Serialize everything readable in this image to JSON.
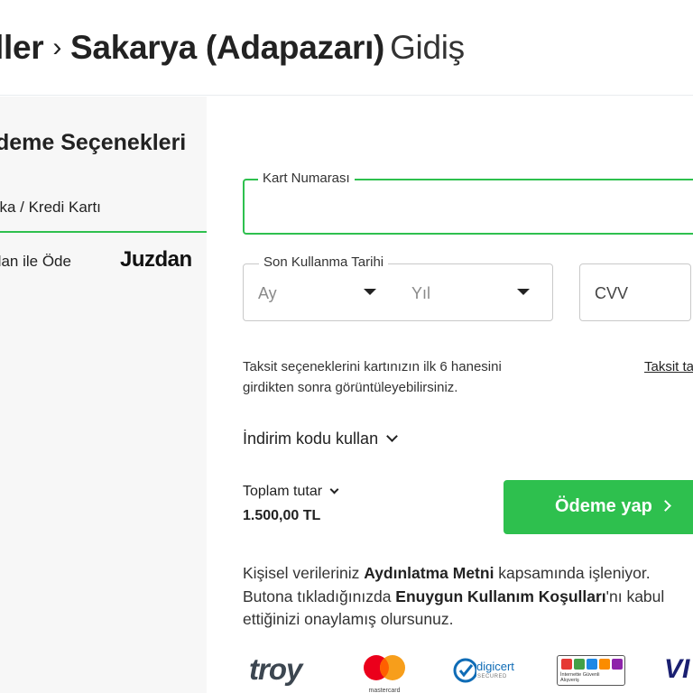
{
  "header": {
    "origin": "ller",
    "destination": "Sakarya (Adapazarı)",
    "direction": "Gidiş"
  },
  "sidebar": {
    "title": "deme Seçenekleri",
    "tabs": [
      {
        "label": "nka / Kredi Kartı",
        "active": true
      },
      {
        "label": "dan ile Öde",
        "logo": "Juzdan"
      }
    ]
  },
  "form": {
    "card_number_label": "Kart Numarası",
    "card_number_value": "",
    "expiry_label": "Son Kullanma Tarihi",
    "month_placeholder": "Ay",
    "year_placeholder": "Yıl",
    "cvv_placeholder": "CVV"
  },
  "installment": {
    "info": "Taksit seçeneklerini kartınızın ilk 6 hanesini girdikten sonra görüntüleyebilirsiniz.",
    "link": "Taksit ta"
  },
  "discount": {
    "label": "İndirim kodu kullan"
  },
  "total": {
    "label": "Toplam tutar",
    "value": "1.500,00 TL"
  },
  "pay_button": {
    "label": "Ödeme yap"
  },
  "legal": {
    "p1": "Kişisel verileriniz ",
    "link1": "Aydınlatma Metni",
    "p2": " kapsamında işleniyor. Butona tıkladığınızda ",
    "link2": "Enuygun Kullanım Koşulları",
    "p3": "'nı kabul ettiğinizi onaylamış olursunuz."
  },
  "payment_logos": {
    "troy": "troy",
    "mastercard": "mastercard",
    "digicert": "digicert",
    "digicert_sub": "SECURED",
    "trust_seal": "İnternette Güvenli Alışveriş",
    "visa": "VI"
  },
  "colors": {
    "accent": "#2ec04e",
    "sidebar_bg": "#f7f7f7"
  }
}
